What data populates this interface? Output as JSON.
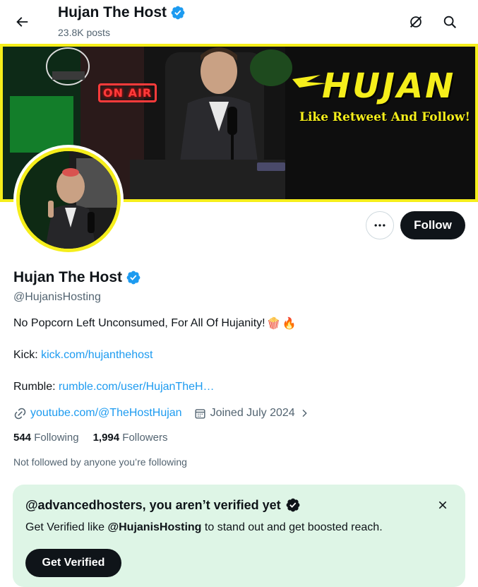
{
  "header": {
    "title": "Hujan The Host",
    "posts_count": "23.8K posts",
    "icons": [
      "back-arrow-icon",
      "grok-icon",
      "search-icon"
    ]
  },
  "banner": {
    "title": "HUJAN",
    "tagline": "Like Retweet And Follow!",
    "sign_text": "ON AIR",
    "accent_color": "#f5ee1b"
  },
  "actions": {
    "more_icon": "more-dots-icon",
    "follow_label": "Follow"
  },
  "profile": {
    "display_name": "Hujan The Host",
    "verified": true,
    "handle": "@HujanisHosting",
    "bio": "No Popcorn Left Unconsumed, For All Of Hujanity!",
    "bio_emojis": [
      "🍿",
      "🔥"
    ],
    "kick_label": "Kick:",
    "kick_link": "kick.com/hujanthehost",
    "rumble_label": "Rumble:",
    "rumble_link": "rumble.com/user/HujanTheH…",
    "website": "youtube.com/@TheHostHujan",
    "joined": "Joined July 2024",
    "following_count": "544",
    "following_label": "Following",
    "followers_count": "1,994",
    "followers_label": "Followers",
    "not_followed_text": "Not followed by anyone you’re following"
  },
  "verify_card": {
    "title": "@advancedhosters, you aren’t verified yet",
    "desc_prefix": "Get Verified like",
    "desc_handle": "@HujanisHosting",
    "desc_suffix": "to stand out and get boosted reach.",
    "button_label": "Get Verified",
    "background_color": "#def5e6"
  },
  "colors": {
    "link": "#1d9bf0",
    "verified_badge": "#1d9bf0",
    "text_secondary": "#536471",
    "button_dark": "#0f1419"
  }
}
